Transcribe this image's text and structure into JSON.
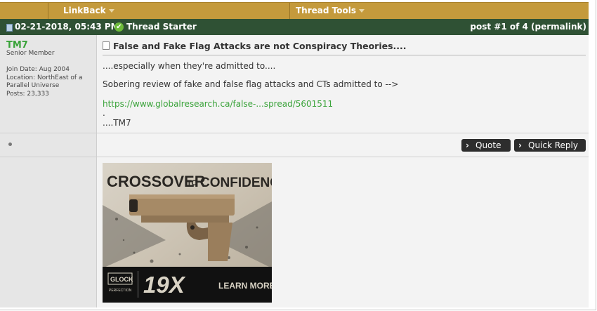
{
  "topbar": {
    "linkback": "LinkBack",
    "thread_tools": "Thread Tools"
  },
  "post_header": {
    "datetime": "02-21-2018, 05:43 PM",
    "badge": "Thread Starter",
    "post_info": "post #1 of 4 (permalink)"
  },
  "user": {
    "name": "TM7",
    "title": "Senior Member",
    "join_date": "Join Date: Aug 2004",
    "location": "Location: NorthEast of a Parallel Universe",
    "posts": "Posts: 23,333"
  },
  "post": {
    "title": "False and Fake Flag Attacks are not Conspiracy Theories....",
    "line1": "....especially when they're admitted to....",
    "line2": "Sobering review of fake and false flag attacks and CTs admitted to -->",
    "link": "https://www.globalresearch.ca/false-...spread/5601511",
    "dot": ".",
    "signoff": "....TM7"
  },
  "actions": {
    "quote": "Quote",
    "quick_reply": "Quick Reply"
  },
  "ad": {
    "headline_left": "CROSSOVER",
    "headline_to": "TO",
    "headline_right": "CONFIDENCE",
    "brand": "GLOCK",
    "brand_sub": "PERFECTION",
    "model": "19X",
    "cta": "LEARN MORE"
  },
  "icons": [
    "post-doc-icon",
    "thread-starter-check-icon",
    "chevron-right-icon",
    "bullet-icon"
  ],
  "colors": {
    "gold_bar": "#c49a3c",
    "green_header": "#2f5134",
    "username_green": "#3aa33a",
    "button_dark": "#2d2d2d"
  }
}
